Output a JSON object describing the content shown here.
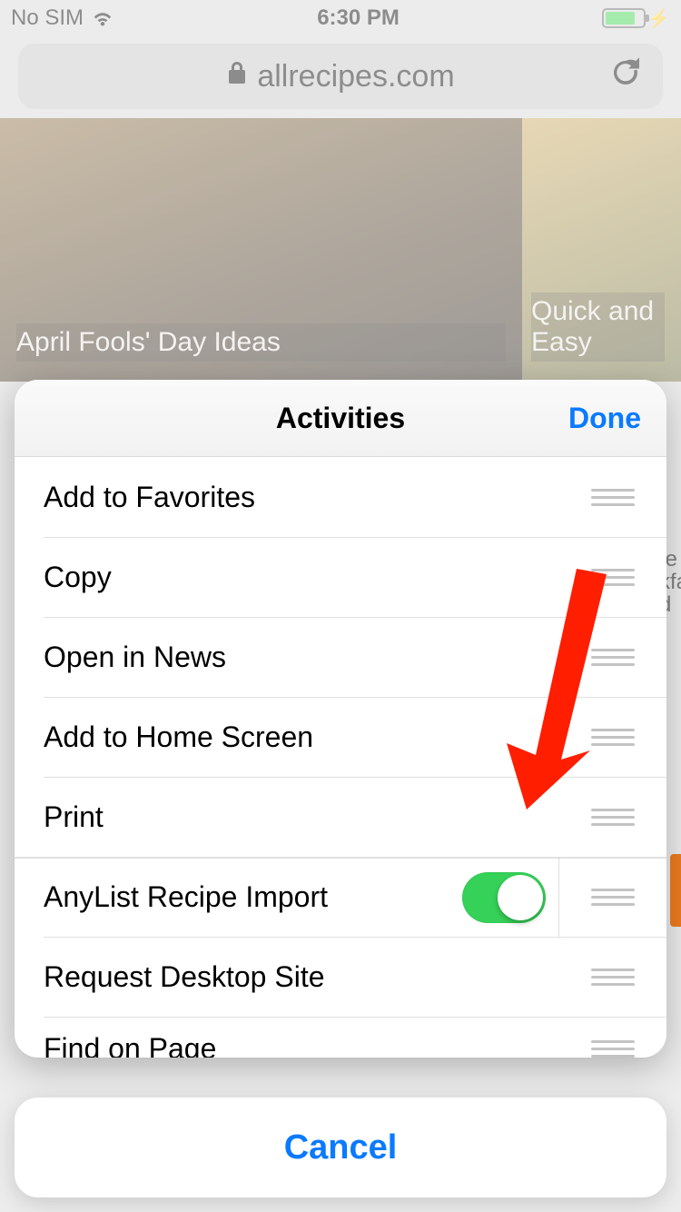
{
  "status": {
    "carrier": "No SIM",
    "time": "6:30 PM"
  },
  "browser": {
    "domain": "allrecipes.com"
  },
  "hero": {
    "tile1": "April Fools' Day Ideas",
    "tile2": "Quick and Easy"
  },
  "peek_text": "te\nkfa\nd",
  "sheet": {
    "title": "Activities",
    "done": "Done",
    "items": [
      {
        "label": "Add to Favorites",
        "toggle": false
      },
      {
        "label": "Copy",
        "toggle": false
      },
      {
        "label": "Open in News",
        "toggle": false
      },
      {
        "label": "Add to Home Screen",
        "toggle": false
      },
      {
        "label": "Print",
        "toggle": false
      },
      {
        "label": "AnyList Recipe Import",
        "toggle": true,
        "on": true
      },
      {
        "label": "Request Desktop Site",
        "toggle": false
      },
      {
        "label": "Find on Page",
        "toggle": false
      }
    ]
  },
  "cancel": "Cancel"
}
